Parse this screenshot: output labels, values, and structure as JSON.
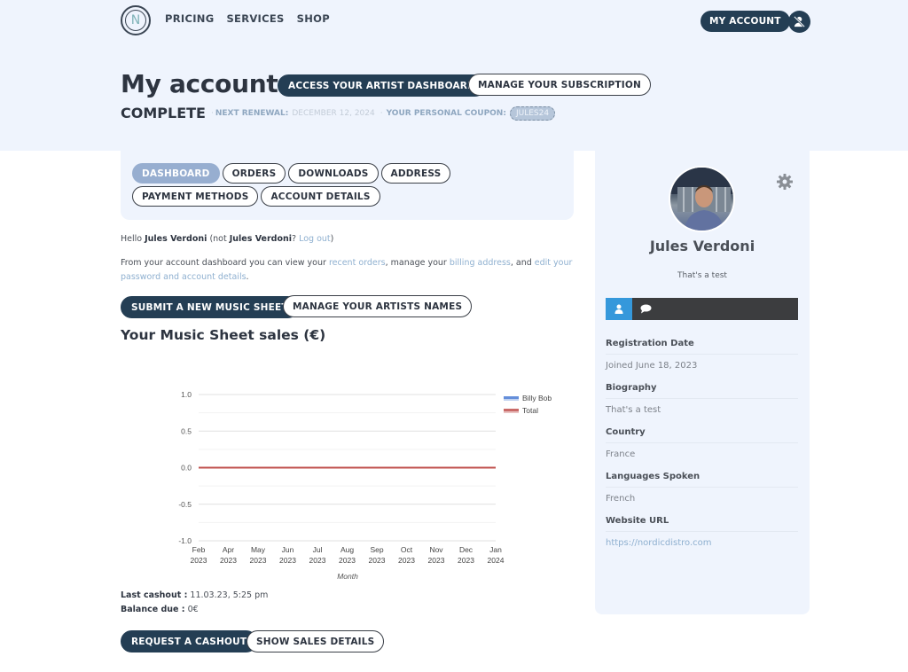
{
  "header": {
    "logo_letter": "N",
    "nav": [
      "PRICING",
      "SERVICES",
      "SHOP"
    ],
    "my_account_label": "MY ACCOUNT"
  },
  "page": {
    "title": "My account",
    "artist_dashboard_label": "ACCESS YOUR ARTIST DASHBOARD",
    "manage_subscription_label": "MANAGE YOUR SUBSCRIPTION",
    "status": "COMPLETE",
    "next_renewal_label": "NEXT RENEWAL:",
    "next_renewal_value": "DECEMBER 12, 2024",
    "coupon_label": "YOUR PERSONAL COUPON:",
    "coupon_value": "JULES24",
    "separator": "·"
  },
  "tabs": [
    {
      "label": "DASHBOARD",
      "active": true
    },
    {
      "label": "ORDERS",
      "active": false
    },
    {
      "label": "DOWNLOADS",
      "active": false
    },
    {
      "label": "ADDRESS",
      "active": false
    },
    {
      "label": "PAYMENT METHODS",
      "active": false
    },
    {
      "label": "ACCOUNT DETAILS",
      "active": false
    }
  ],
  "intro": {
    "hello": "Hello",
    "user_name": "Jules Verdoni",
    "not_prefix": "(not",
    "not_suffix": "?",
    "logout": "Log out",
    "close_paren": ")",
    "text1": "From your account dashboard you can view your",
    "recent_orders": "recent orders",
    "text2": ", manage your",
    "billing_address": "billing address",
    "text3": ", and",
    "edit_details": "edit your password and account details",
    "text4": "."
  },
  "actions": {
    "submit_sheet": "SUBMIT A NEW MUSIC SHEET",
    "manage_artists": "MANAGE YOUR ARTISTS NAMES",
    "sales_title": "Your Music Sheet sales (€)"
  },
  "chart_data": {
    "type": "line",
    "title": "",
    "xlabel": "Month",
    "ylabel": "",
    "ylim": [
      -1.0,
      1.0
    ],
    "yticks": [
      "1.0",
      "0.5",
      "0.0",
      "-0.5",
      "-1.0"
    ],
    "ytick_values": [
      1.0,
      0.5,
      0.0,
      -0.5,
      -1.0
    ],
    "categories": [
      [
        "Feb",
        "2023"
      ],
      [
        "Apr",
        "2023"
      ],
      [
        "May",
        "2023"
      ],
      [
        "Jun",
        "2023"
      ],
      [
        "Jul",
        "2023"
      ],
      [
        "Aug",
        "2023"
      ],
      [
        "Sep",
        "2023"
      ],
      [
        "Oct",
        "2023"
      ],
      [
        "Nov",
        "2023"
      ],
      [
        "Dec",
        "2023"
      ],
      [
        "Jan",
        "2024"
      ]
    ],
    "series": [
      {
        "name": "Billy Bob",
        "color": "#4a7bd4",
        "values": [
          0,
          0,
          0,
          0,
          0,
          0,
          0,
          0,
          0,
          0,
          0
        ]
      },
      {
        "name": "Total",
        "color": "#c0504d",
        "values": [
          0,
          0,
          0,
          0,
          0,
          0,
          0,
          0,
          0,
          0,
          0
        ]
      }
    ],
    "grid": true,
    "legend": "top-right"
  },
  "cashout": {
    "last_label": "Last cashout :",
    "last_value": "11.03.23, 5:25 pm",
    "balance_label": "Balance due :",
    "balance_value": "0€",
    "request_label": "REQUEST A CASHOUT",
    "details_label": "SHOW SALES DETAILS"
  },
  "profile": {
    "name": "Jules Verdoni",
    "bio": "That's a test",
    "fields": [
      {
        "label": "Registration Date",
        "value": "Joined June 18, 2023",
        "link": false
      },
      {
        "label": "Biography",
        "value": "That's a test",
        "link": false
      },
      {
        "label": "Country",
        "value": "France",
        "link": false
      },
      {
        "label": "Languages Spoken",
        "value": "French",
        "link": false
      },
      {
        "label": "Website URL",
        "value": "https://nordicdistro.com",
        "link": true
      }
    ]
  }
}
